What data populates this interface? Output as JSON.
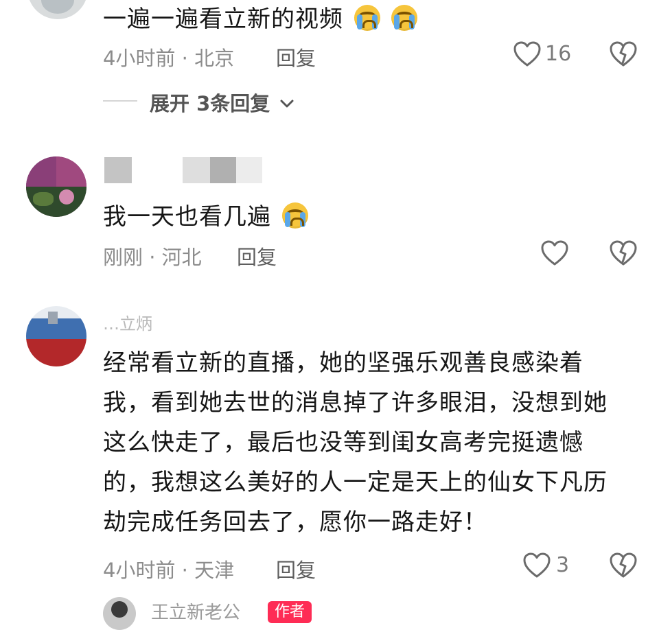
{
  "comment1": {
    "text": "一遍一遍看立新的视频",
    "emoji": [
      "crying-face",
      "crying-face"
    ],
    "time_location": "4小时前 · 北京",
    "reply_label": "回复",
    "like_count": "16",
    "expand_label": "展开 3条回复"
  },
  "comment2": {
    "text": "我一天也看几遍",
    "emoji": [
      "crying-face"
    ],
    "time_location": "刚刚 · 河北",
    "reply_label": "回复"
  },
  "comment3": {
    "username": "…立炳",
    "lines": [
      "经常看立新的直播，她的坚强乐观善良感染着",
      "我，看到她去世的消息掉了许多眼泪，没想到她",
      "这么快走了，最后也没等到闺女高考完挺遗憾",
      "的，我想这么美好的人一定是天上的仙女下凡历",
      "劫完成任务回去了，愿你一路走好！"
    ],
    "time_location": "4小时前 · 天津",
    "reply_label": "回复",
    "like_count": "3"
  },
  "comment4": {
    "username": "王立新老公",
    "badge": "作者"
  },
  "colors": {
    "accent_badge": "#fe2c55",
    "icon_gray": "#6b6b6b"
  }
}
